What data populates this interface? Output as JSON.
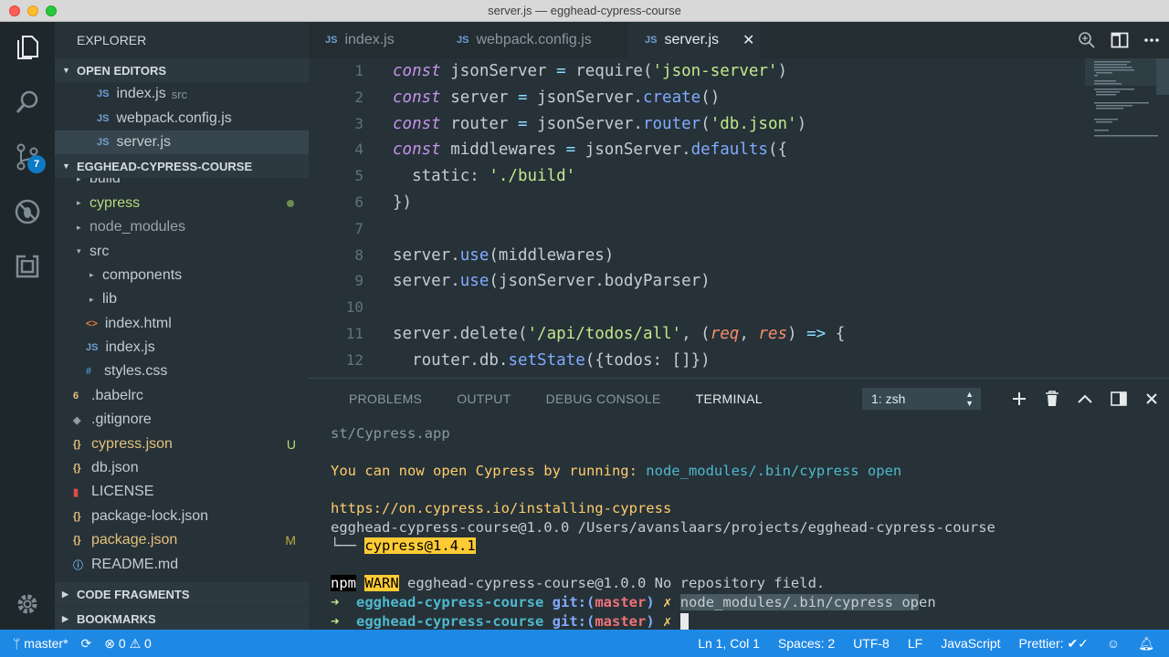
{
  "window": {
    "title": "server.js — egghead-cypress-course"
  },
  "activity": {
    "scm_badge": "7"
  },
  "sidebar": {
    "title": "EXPLORER",
    "open_editors_label": "OPEN EDITORS",
    "open_editors": [
      {
        "icon": "JS",
        "name": "index.js",
        "desc": "src"
      },
      {
        "icon": "JS",
        "name": "webpack.config.js",
        "desc": ""
      },
      {
        "icon": "JS",
        "name": "server.js",
        "desc": ""
      }
    ],
    "project_label": "EGGHEAD-CYPRESS-COURSE",
    "tree": [
      {
        "name": "build",
        "type": "folder",
        "twisty": "▸"
      },
      {
        "name": "cypress",
        "type": "folder",
        "twisty": "▸"
      },
      {
        "name": "node_modules",
        "type": "folder",
        "twisty": "▸"
      },
      {
        "name": "src",
        "type": "folder",
        "twisty": "▾"
      },
      {
        "name": "components",
        "type": "folder",
        "twisty": "▸"
      },
      {
        "name": "lib",
        "type": "folder",
        "twisty": "▸"
      },
      {
        "name": "index.html",
        "type": "file",
        "icon": "<>"
      },
      {
        "name": "index.js",
        "type": "file",
        "icon": "JS"
      },
      {
        "name": "styles.css",
        "type": "file",
        "icon": "#"
      },
      {
        "name": ".babelrc",
        "type": "file",
        "icon": "6"
      },
      {
        "name": ".gitignore",
        "type": "file",
        "icon": "◈"
      },
      {
        "name": "cypress.json",
        "type": "file",
        "icon": "{}",
        "deco": "U"
      },
      {
        "name": "db.json",
        "type": "file",
        "icon": "{}"
      },
      {
        "name": "LICENSE",
        "type": "file",
        "icon": "▮"
      },
      {
        "name": "package-lock.json",
        "type": "file",
        "icon": "{}"
      },
      {
        "name": "package.json",
        "type": "file",
        "icon": "{}",
        "deco": "M"
      },
      {
        "name": "README.md",
        "type": "file",
        "icon": "ⓘ"
      }
    ],
    "code_fragments_label": "CODE FRAGMENTS",
    "bookmarks_label": "BOOKMARKS"
  },
  "tabs": [
    {
      "icon": "JS",
      "label": "index.js"
    },
    {
      "icon": "JS",
      "label": "webpack.config.js"
    },
    {
      "icon": "JS",
      "label": "server.js",
      "close": "✕"
    }
  ],
  "editor": {
    "lines": [
      {
        "n": "1",
        "tokens": [
          [
            "kw",
            "const"
          ],
          [
            "t",
            " jsonServer "
          ],
          [
            "op",
            "="
          ],
          [
            "t",
            " require("
          ],
          [
            "str",
            "'json-server'"
          ],
          [
            "t",
            ")"
          ]
        ]
      },
      {
        "n": "2",
        "tokens": [
          [
            "kw",
            "const"
          ],
          [
            "t",
            " server "
          ],
          [
            "op",
            "="
          ],
          [
            "t",
            " jsonServer."
          ],
          [
            "fn",
            "create"
          ],
          [
            "t",
            "()"
          ]
        ]
      },
      {
        "n": "3",
        "tokens": [
          [
            "kw",
            "const"
          ],
          [
            "t",
            " router "
          ],
          [
            "op",
            "="
          ],
          [
            "t",
            " jsonServer."
          ],
          [
            "fn",
            "router"
          ],
          [
            "t",
            "("
          ],
          [
            "str",
            "'db.json'"
          ],
          [
            "t",
            ")"
          ]
        ]
      },
      {
        "n": "4",
        "tokens": [
          [
            "kw",
            "const"
          ],
          [
            "t",
            " middlewares "
          ],
          [
            "op",
            "="
          ],
          [
            "t",
            " jsonServer."
          ],
          [
            "fn",
            "defaults"
          ],
          [
            "t",
            "({"
          ]
        ]
      },
      {
        "n": "5",
        "tokens": [
          [
            "t",
            "  static: "
          ],
          [
            "str",
            "'./build'"
          ]
        ]
      },
      {
        "n": "6",
        "tokens": [
          [
            "t",
            "})"
          ]
        ]
      },
      {
        "n": "7",
        "tokens": []
      },
      {
        "n": "8",
        "tokens": [
          [
            "t",
            "server."
          ],
          [
            "fn",
            "use"
          ],
          [
            "t",
            "(middlewares)"
          ]
        ]
      },
      {
        "n": "9",
        "tokens": [
          [
            "t",
            "server."
          ],
          [
            "fn",
            "use"
          ],
          [
            "t",
            "(jsonServer.bodyParser)"
          ]
        ]
      },
      {
        "n": "10",
        "tokens": []
      },
      {
        "n": "11",
        "tokens": [
          [
            "t",
            "server.delete("
          ],
          [
            "str",
            "'/api/todos/all'"
          ],
          [
            "t",
            ", ("
          ],
          [
            "param",
            "req"
          ],
          [
            "t",
            ", "
          ],
          [
            "param",
            "res"
          ],
          [
            "t",
            ") "
          ],
          [
            "op",
            "=>"
          ],
          [
            "t",
            " {"
          ]
        ]
      },
      {
        "n": "12",
        "tokens": [
          [
            "t",
            "  router.db."
          ],
          [
            "fn",
            "setState"
          ],
          [
            "t",
            "({todos: []})"
          ]
        ]
      }
    ]
  },
  "panel": {
    "tabs": [
      "PROBLEMS",
      "OUTPUT",
      "DEBUG CONSOLE",
      "TERMINAL"
    ],
    "active_tab": "TERMINAL",
    "shell": "1: zsh",
    "terminal": {
      "l1": "st/Cypress.app",
      "l2a": "You can now open Cypress by running: ",
      "l2b": "node_modules/.bin/cypress open",
      "l3": "https://on.cypress.io/installing-cypress",
      "l4": "egghead-cypress-course@1.0.0 /Users/avanslaars/projects/egghead-cypress-course",
      "l5a": "└── ",
      "l5b": "cypress@1.4.1",
      "l6a": "npm",
      "l6b": "WARN",
      "l6c": " egghead-cypress-course@1.0.0 No repository field.",
      "prompt_arrow": "➜",
      "prompt_dir": "egghead-cypress-course",
      "prompt_git": "git:(",
      "prompt_branch": "master",
      "prompt_close": ")",
      "prompt_x": "✗",
      "cmd_sel": "node_modules/.bin/cypress op",
      "cmd_rest": "en"
    }
  },
  "status": {
    "branch": "master*",
    "errors": "0",
    "warnings": "0",
    "position": "Ln 1, Col 1",
    "spaces": "Spaces: 2",
    "encoding": "UTF-8",
    "eol": "LF",
    "language": "JavaScript",
    "prettier": "Prettier: ✔✓"
  },
  "colors": {
    "status_bar": "#1e88e5",
    "accent_badge": "#0e7ac4",
    "editor_bg": "#263238"
  }
}
